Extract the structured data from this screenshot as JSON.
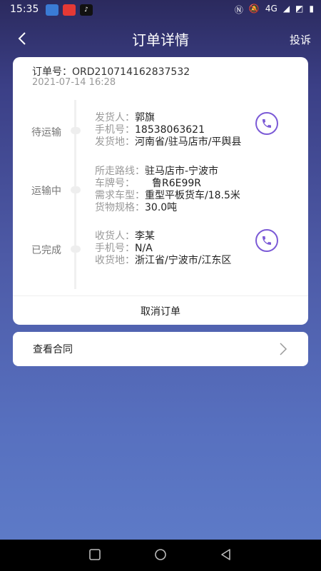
{
  "status_bar": {
    "time": "15:35",
    "network": "4G"
  },
  "header": {
    "title": "订单详情",
    "complaint": "投诉"
  },
  "order": {
    "number": "订单号：ORD210714162837532",
    "datetime": "2021-07-14 16:28"
  },
  "timeline": [
    {
      "status": "待运输",
      "rows": [
        {
          "label": "发货人：",
          "value": "郭旗"
        },
        {
          "label": "手机号：",
          "value": "18538063621"
        },
        {
          "label": "发货地：",
          "value": "河南省/驻马店市/平舆县"
        }
      ]
    },
    {
      "status": "运输中",
      "rows": [
        {
          "label": "所走路线：",
          "value": "驻马店市-宁波市"
        },
        {
          "label": "车牌号：",
          "value": "鲁R6E99R"
        },
        {
          "label": "需求车型：",
          "value": "重型平板货车/18.5米"
        },
        {
          "label": "货物规格：",
          "value": "30.0吨"
        }
      ]
    },
    {
      "status": "已完成",
      "rows": [
        {
          "label": "收货人：",
          "value": "李某"
        },
        {
          "label": "手机号：",
          "value": "N/A"
        },
        {
          "label": "收货地：",
          "value": "浙江省/宁波市/江东区"
        }
      ]
    }
  ],
  "actions": {
    "cancel_order": "取消订单",
    "view_contract": "查看合同"
  },
  "colors": {
    "accent": "#7b5ad6"
  },
  "icons": {
    "back": "back-icon",
    "phone": "phone-icon",
    "chevron": "chevron-right-icon"
  }
}
